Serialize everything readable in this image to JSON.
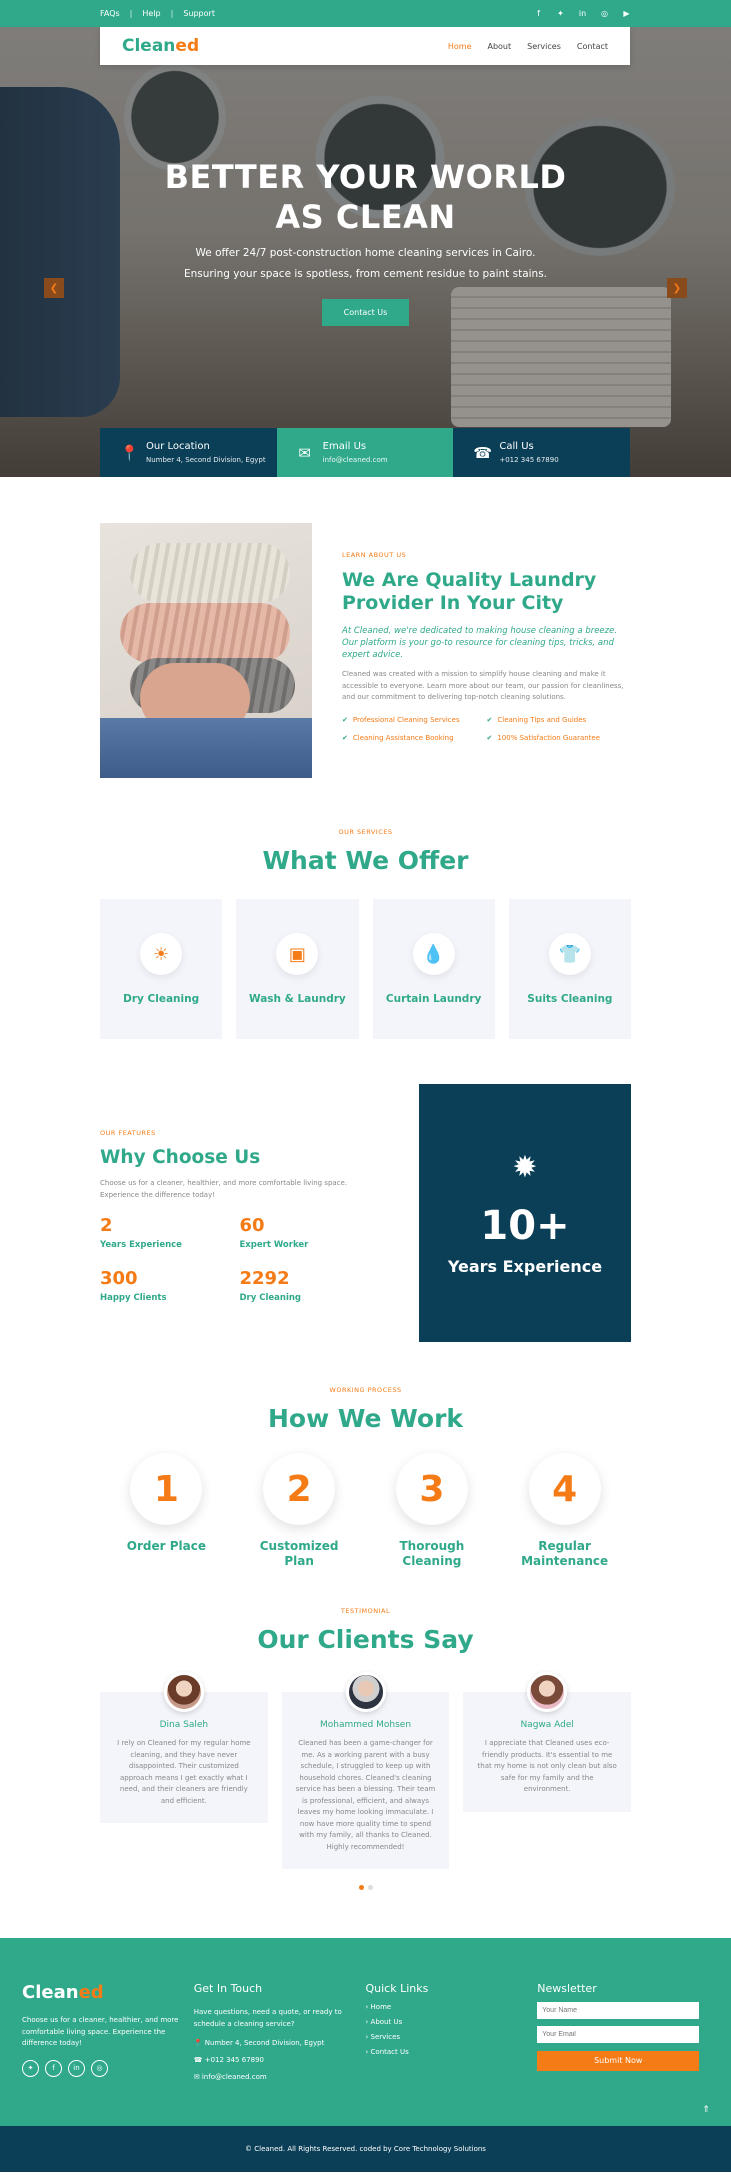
{
  "topbar": {
    "links": [
      "FAQs",
      "Help",
      "Support"
    ],
    "social": [
      "facebook-icon",
      "twitter-icon",
      "linkedin-icon",
      "instagram-icon",
      "youtube-icon"
    ]
  },
  "nav": {
    "logo_a": "Clean",
    "logo_b": "ed",
    "items": [
      "Home",
      "About",
      "Services",
      "Contact"
    ],
    "active": "Home"
  },
  "hero": {
    "title_line1": "BETTER YOUR WORLD",
    "title_line2": "AS CLEAN",
    "sub_line1": "We offer 24/7 post-construction home cleaning services in Cairo.",
    "sub_line2": "Ensuring your space is spotless, from cement residue to paint stains.",
    "cta": "Contact Us",
    "info": [
      {
        "title": "Our Location",
        "value": "Number 4, Second Division, Egypt"
      },
      {
        "title": "Email Us",
        "value": "info@cleaned.com"
      },
      {
        "title": "Call Us",
        "value": "+012 345 67890"
      }
    ]
  },
  "about": {
    "kicker": "LEARN ABOUT US",
    "title": "We Are Quality Laundry Provider In Your City",
    "lead": "At Cleaned, we're dedicated to making house cleaning a breeze. Our platform is your go-to resource for cleaning tips, tricks, and expert advice.",
    "body": "Cleaned was created with a mission to simplify house cleaning and make it accessible to everyone. Learn more about our team, our passion for cleanliness, and our commitment to delivering top-notch cleaning solutions.",
    "checks": [
      "Professional Cleaning Services",
      "Cleaning Tips and Guides",
      "Cleaning Assistance Booking",
      "100% Satisfaction Guarantee"
    ]
  },
  "offer": {
    "kicker": "OUR SERVICES",
    "title": "What We Offer",
    "cards": [
      "Dry Cleaning",
      "Wash & Laundry",
      "Curtain Laundry",
      "Suits Cleaning"
    ]
  },
  "why": {
    "kicker": "OUR FEATURES",
    "title": "Why Choose Us",
    "body": "Choose us for a cleaner, healthier, and more comfortable living space. Experience the difference today!",
    "stats": [
      {
        "n": "2",
        "l": "Years Experience"
      },
      {
        "n": "60",
        "l": "Expert Worker"
      },
      {
        "n": "300",
        "l": "Happy Clients"
      },
      {
        "n": "2292",
        "l": "Dry Cleaning"
      }
    ],
    "box_number": "10+",
    "box_label": "Years Experience"
  },
  "work": {
    "kicker": "WORKING PROCESS",
    "title": "How We Work",
    "steps": [
      {
        "n": "1",
        "l": "Order Place"
      },
      {
        "n": "2",
        "l": "Customized Plan"
      },
      {
        "n": "3",
        "l": "Thorough Cleaning"
      },
      {
        "n": "4",
        "l": "Regular Maintenance"
      }
    ]
  },
  "testimonials": {
    "kicker": "TESTIMONIAL",
    "title": "Our Clients Say",
    "items": [
      {
        "name": "Dina Saleh",
        "text": "I rely on Cleaned for my regular home cleaning, and they have never disappointed. Their customized approach means I get exactly what I need, and their cleaners are friendly and efficient."
      },
      {
        "name": "Mohammed Mohsen",
        "text": "Cleaned has been a game-changer for me. As a working parent with a busy schedule, I struggled to keep up with household chores. Cleaned's cleaning service has been a blessing. Their team is professional, efficient, and always leaves my home looking immaculate. I now have more quality time to spend with my family, all thanks to Cleaned. Highly recommended!"
      },
      {
        "name": "Nagwa Adel",
        "text": "I appreciate that Cleaned uses eco-friendly products. It's essential to me that my home is not only clean but also safe for my family and the environment."
      }
    ]
  },
  "footer": {
    "logo_a": "Clean",
    "logo_b": "ed",
    "about": "Choose us for a cleaner, healthier, and more comfortable living space. Experience the difference today!",
    "touch_title": "Get In Touch",
    "touch_text": "Have questions, need a quote, or ready to schedule a cleaning service?",
    "address": "Number 4, Second Division, Egypt",
    "phone": "+012 345 67890",
    "email": "info@cleaned.com",
    "links_title": "Quick Links",
    "links": [
      "Home",
      "About Us",
      "Services",
      "Contact Us"
    ],
    "news_title": "Newsletter",
    "name_ph": "Your Name",
    "email_ph": "Your Email",
    "submit": "Submit Now",
    "copyright": "© Cleaned. All Rights Reserved. coded by Core Technology Solutions"
  },
  "colors": {
    "green": "#2fa98a",
    "orange": "#f47b16",
    "navy": "#0b3f57"
  }
}
